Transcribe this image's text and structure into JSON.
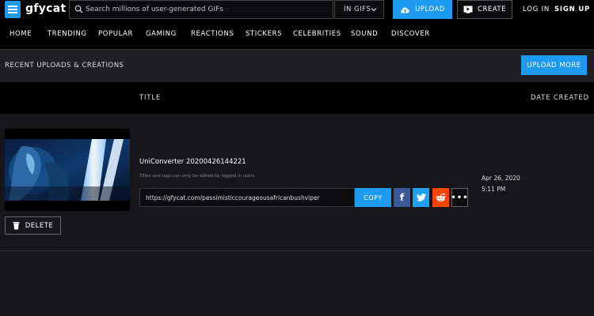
{
  "brand": {
    "logo_text": "gfycat"
  },
  "search": {
    "placeholder": "Search millions of user-generated GIFs",
    "scope": "IN GIFS"
  },
  "header": {
    "upload_label": "UPLOAD",
    "create_label": "CREATE",
    "login_label": "LOG IN",
    "signup_label": "SIGN UP"
  },
  "nav": {
    "items": [
      "HOME",
      "TRENDING",
      "POPULAR",
      "GAMING",
      "REACTIONS",
      "STICKERS",
      "CELEBRITIES",
      "SOUND",
      "DISCOVER"
    ]
  },
  "recent": {
    "title": "RECENT UPLOADS & CREATIONS",
    "upload_more_label": "UPLOAD MORE"
  },
  "table": {
    "columns": [
      "TITLE",
      "DATE CREATED"
    ],
    "rows": [
      {
        "title": "UniConverter 20200426144221",
        "note": "Titles and tags can only be edited by logged in users",
        "url": "https://gfycat.com/pessimisticcourageousafricanbushviper",
        "copy_label": "COPY",
        "delete_label": "DELETE",
        "date": "Apr 26, 2020",
        "time": "5:11 PM",
        "share": {
          "facebook": "f",
          "more": "•••"
        }
      }
    ]
  },
  "colors": {
    "accent": "#1e9bf0",
    "facebook": "#3b5998",
    "twitter": "#1da1f2",
    "reddit": "#ff4500",
    "topbar": "#000000",
    "page_bg": "#16161b"
  },
  "icons": [
    "menu-icon",
    "search-icon",
    "chevron-down-icon",
    "cloud-upload-icon",
    "create-icon",
    "trash-icon",
    "twitter-icon",
    "reddit-icon"
  ]
}
